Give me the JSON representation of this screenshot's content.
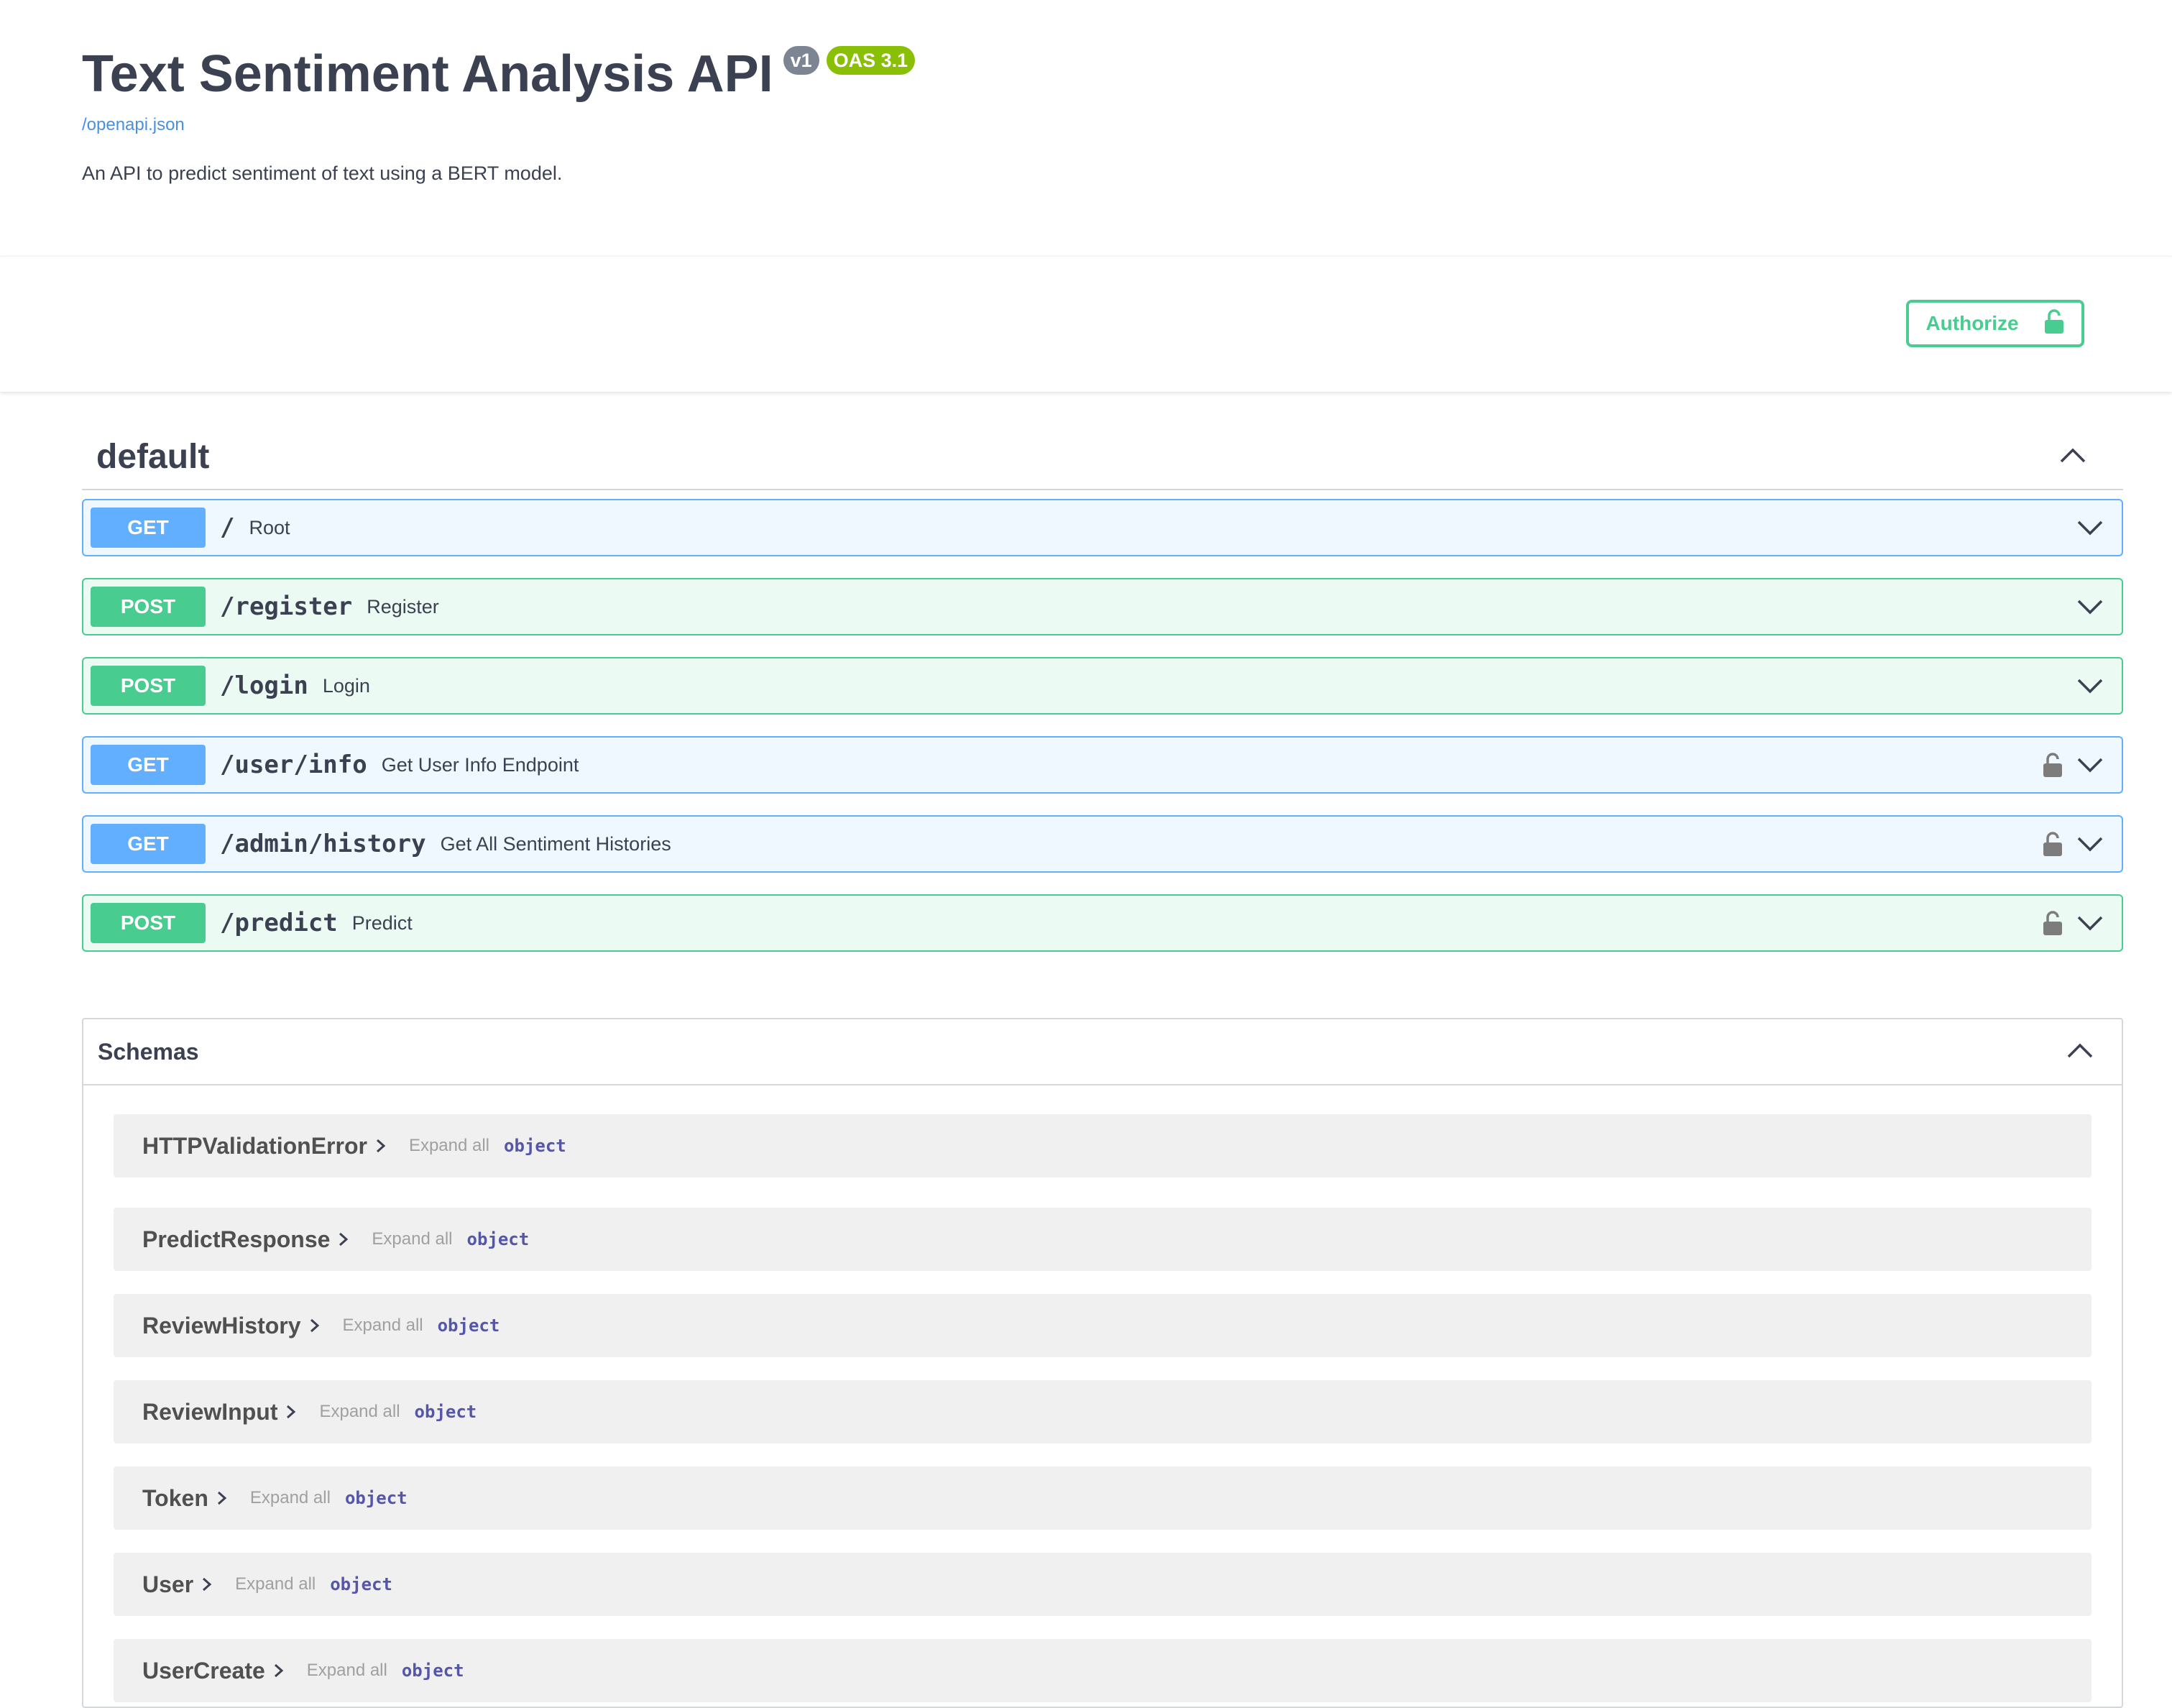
{
  "info": {
    "title": "Text Sentiment Analysis API",
    "version_badge": "v1",
    "oas_badge": "OAS 3.1",
    "spec_link": "/openapi.json",
    "description": "An API to predict sentiment of text using a BERT model."
  },
  "authorize": {
    "label": "Authorize",
    "icon": "unlocked-padlock-icon"
  },
  "tag": {
    "name": "default",
    "expanded": true,
    "operations": [
      {
        "method": "GET",
        "path": "/",
        "summary": "Root",
        "locked": false
      },
      {
        "method": "POST",
        "path": "/register",
        "summary": "Register",
        "locked": false
      },
      {
        "method": "POST",
        "path": "/login",
        "summary": "Login",
        "locked": false
      },
      {
        "method": "GET",
        "path": "/user/info",
        "summary": "Get User Info Endpoint",
        "locked": true
      },
      {
        "method": "GET",
        "path": "/admin/history",
        "summary": "Get All Sentiment Histories",
        "locked": true
      },
      {
        "method": "POST",
        "path": "/predict",
        "summary": "Predict",
        "locked": true
      }
    ]
  },
  "schemas": {
    "title": "Schemas",
    "expanded": true,
    "expand_all_label": "Expand all",
    "items": [
      {
        "name": "HTTPValidationError",
        "type": "object"
      },
      {
        "name": "PredictResponse",
        "type": "object"
      },
      {
        "name": "ReviewHistory",
        "type": "object"
      },
      {
        "name": "ReviewInput",
        "type": "object"
      },
      {
        "name": "Token",
        "type": "object"
      },
      {
        "name": "User",
        "type": "object"
      },
      {
        "name": "UserCreate",
        "type": "object"
      }
    ]
  },
  "colors": {
    "get": "#61affe",
    "post": "#49cc90",
    "oas_badge": "#89bf04",
    "version_badge": "#7d8492",
    "link": "#4990e2",
    "lock": "#7c7c7c"
  }
}
